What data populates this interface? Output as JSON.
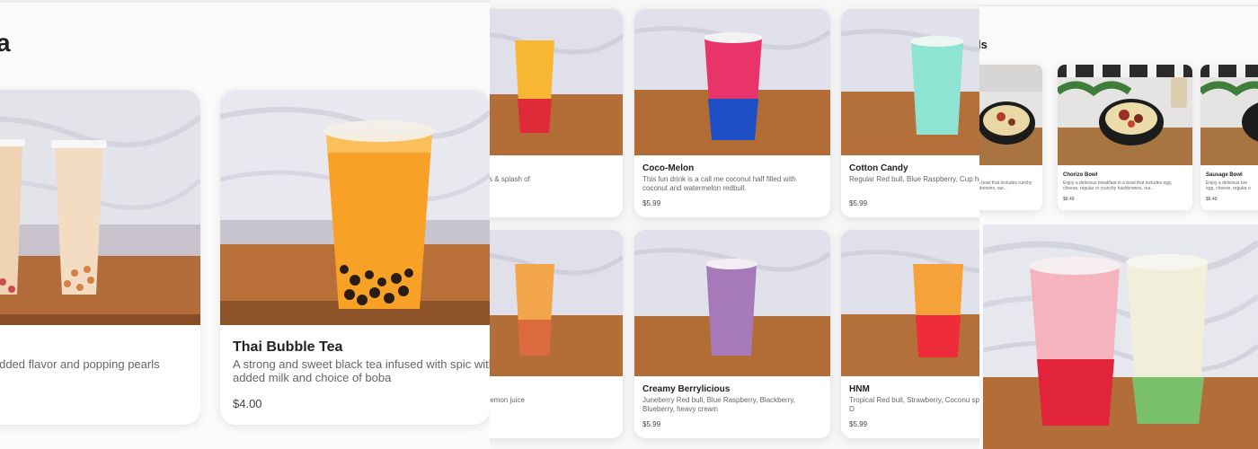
{
  "panel1": {
    "heading": "a",
    "cards": [
      {
        "name": "",
        "desc": "d milk with any added flavor and popping pearls",
        "price": ""
      },
      {
        "name": "Thai Bubble Tea",
        "desc": "A strong and sweet black tea infused with spic with added milk and choice of boba",
        "price": "$4.00"
      }
    ]
  },
  "panel2": {
    "cards": [
      {
        "name": "rst",
        "desc": "Pineapple Flavors & splash of",
        "price": ""
      },
      {
        "name": "Coco-Melon",
        "desc": "This fun drink is a call me coconut half filled with coconut and watermelon redbull.",
        "price": "$5.99"
      },
      {
        "name": "Cotton Candy",
        "desc": "Regular Red bull, Blue Raspberry, Cup half",
        "price": "$5.99"
      },
      {
        "name": "ze",
        "desc": ", Cranberry, and lemon juice",
        "price": ""
      },
      {
        "name": "Creamy Berrylicious",
        "desc": "Juneberry Red bull, Blue Raspberry, Blackberry, Blueberry, heavy cream",
        "price": "$5.99"
      },
      {
        "name": "HNM",
        "desc": "Tropical Red bull, Strawberry, Coconu splash of Sunny D",
        "price": "$5.99"
      }
    ]
  },
  "panel3": {
    "heading": "ls",
    "cards": [
      {
        "name": "",
        "desc": "t in a bowl that includes runchy hashbrowns, our...",
        "price": ""
      },
      {
        "name": "Chorizo Bowl",
        "desc": "Enjoy a delicious breakfast in a bowl that includes egg, cheese, regular or crunchy hashbrowns, our...",
        "price": "$6.49"
      },
      {
        "name": "Sausage Bowl",
        "desc": "Enjoy a delicious bre egg, cheese, regular o",
        "price": "$6.49"
      }
    ]
  }
}
